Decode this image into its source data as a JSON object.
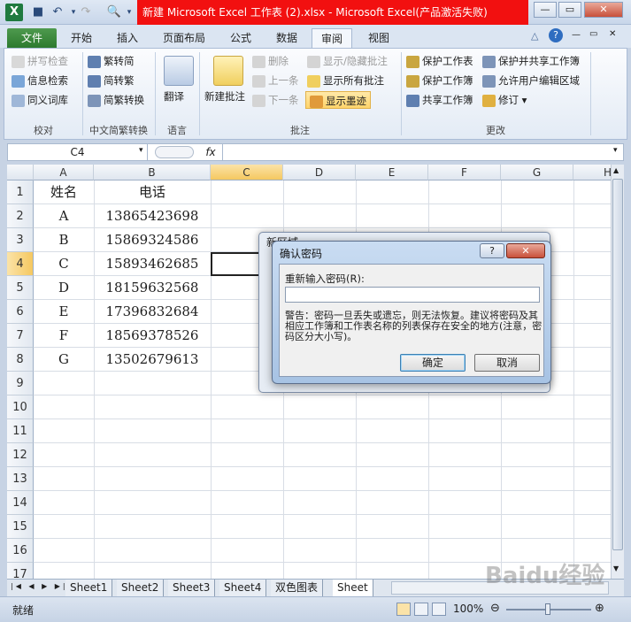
{
  "window": {
    "title": "新建 Microsoft Excel 工作表 (2).xlsx - Microsoft Excel(产品激活失败)",
    "app_icon": "X",
    "minimize": "—",
    "restore": "▭",
    "close": "✕"
  },
  "tabs": [
    "文件",
    "开始",
    "插入",
    "页面布局",
    "公式",
    "数据",
    "审阅",
    "视图"
  ],
  "ribbon": {
    "proofing": {
      "label": "校对",
      "items": [
        "拼写检查",
        "信息检索",
        "同义词库"
      ]
    },
    "chinese": {
      "label": "中文简繁转换",
      "items": [
        "繁转简",
        "简转繁",
        "简繁转换"
      ]
    },
    "language": {
      "label": "语言",
      "translate": "翻译"
    },
    "comments": {
      "label": "批注",
      "new_comment": "新建批注",
      "delete": "删除",
      "prev": "上一条",
      "next": "下一条",
      "show_hide": "显示/隐藏批注",
      "show_all": "显示所有批注",
      "show_ink": "显示墨迹"
    },
    "changes": {
      "label": "更改",
      "protect_sheet": "保护工作表",
      "protect_share": "保护并共享工作簿",
      "protect_book": "保护工作簿",
      "allow_edit": "允许用户编辑区域",
      "share_book": "共享工作簿",
      "track": "修订"
    }
  },
  "formula_bar": {
    "name_box": "C4",
    "fx": "fx",
    "value": ""
  },
  "columns": [
    "A",
    "B",
    "C",
    "D",
    "E",
    "F",
    "G",
    "H"
  ],
  "rows": [
    "1",
    "2",
    "3",
    "4",
    "5",
    "6",
    "7",
    "8",
    "9",
    "10",
    "11",
    "12",
    "13",
    "14",
    "15",
    "16",
    "17"
  ],
  "cells": {
    "header": [
      "姓名",
      "电话"
    ],
    "data": [
      [
        "A",
        "13865423698"
      ],
      [
        "B",
        "15869324586"
      ],
      [
        "C",
        "15893462685"
      ],
      [
        "D",
        "18159632568"
      ],
      [
        "E",
        "17396832684"
      ],
      [
        "F",
        "18569378526"
      ],
      [
        "G",
        "13502679613"
      ]
    ]
  },
  "sheets": [
    "Sheet1",
    "Sheet2",
    "Sheet3",
    "Sheet4",
    "双色图表",
    "Sheet"
  ],
  "status": {
    "ready": "就绪",
    "zoom": "100%"
  },
  "dialog_back": {
    "title": "新区域"
  },
  "dialog": {
    "title": "确认密码",
    "help": "?",
    "close": "✕",
    "label": "重新输入密码(R):",
    "warning": "警告：密码一旦丢失或遗忘，则无法恢复。建议将密码及其相应工作簿和工作表名称的列表保存在安全的地方(注意，密码区分大小写)。",
    "ok": "确定",
    "cancel": "取消"
  },
  "watermark": "Baidu经验"
}
